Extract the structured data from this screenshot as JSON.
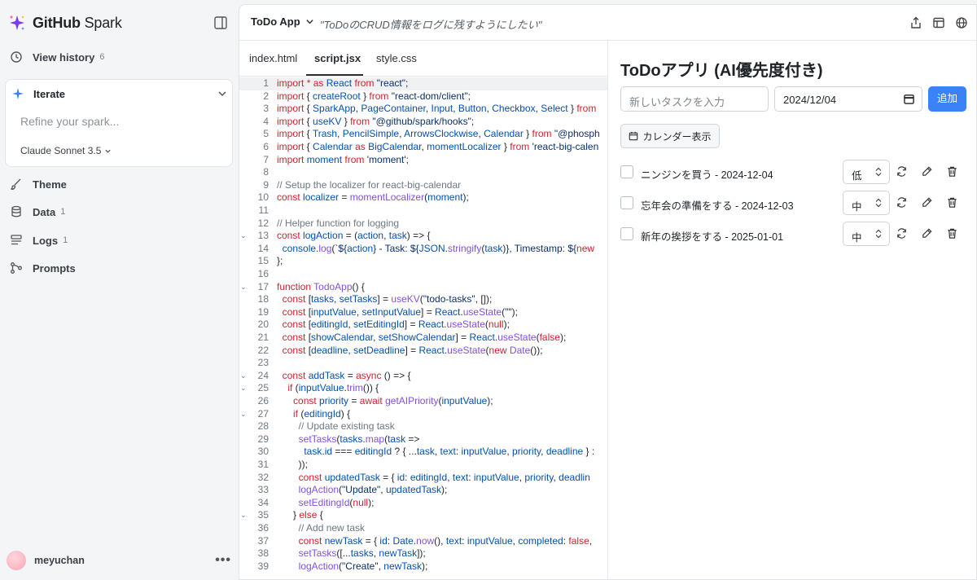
{
  "sidebar": {
    "brand_main": "GitHub",
    "brand_sub": " Spark",
    "view_history": {
      "label": "View history",
      "count": "6"
    },
    "iterate": {
      "label": "Iterate",
      "placeholder": "Refine your spark...",
      "model": "Claude Sonnet 3.5"
    },
    "items": [
      {
        "label": "Theme",
        "count": ""
      },
      {
        "label": "Data",
        "count": "1"
      },
      {
        "label": "Logs",
        "count": "1"
      },
      {
        "label": "Prompts",
        "count": ""
      }
    ],
    "user": "meyuchan"
  },
  "topbar": {
    "app_name": "ToDo App",
    "prompt": "\"ToDoのCRUD情報をログに残すようにしたい\""
  },
  "editor": {
    "tabs": [
      "index.html",
      "script.jsx",
      "style.css"
    ],
    "active_tab": "script.jsx",
    "lines": [
      {
        "n": "1",
        "fold": "",
        "html": "<span class=\"kw\">import</span> <span class=\"kw\">*</span> <span class=\"kw\">as</span> <span class=\"id\">React</span> <span class=\"kw\">from</span> <span class=\"str\">\"react\"</span>;"
      },
      {
        "n": "2",
        "fold": "",
        "html": "<span class=\"kw\">import</span> { <span class=\"id\">createRoot</span> } <span class=\"kw\">from</span> <span class=\"str\">\"react-dom/client\"</span>;"
      },
      {
        "n": "3",
        "fold": "",
        "html": "<span class=\"kw\">import</span> { <span class=\"id\">SparkApp</span>, <span class=\"id\">PageContainer</span>, <span class=\"id\">Input</span>, <span class=\"id\">Button</span>, <span class=\"id\">Checkbox</span>, <span class=\"id\">Select</span> } <span class=\"kw\">from</span>"
      },
      {
        "n": "4",
        "fold": "",
        "html": "<span class=\"kw\">import</span> { <span class=\"id\">useKV</span> } <span class=\"kw\">from</span> <span class=\"str\">\"@github/spark/hooks\"</span>;"
      },
      {
        "n": "5",
        "fold": "",
        "html": "<span class=\"kw\">import</span> { <span class=\"id\">Trash</span>, <span class=\"id\">PencilSimple</span>, <span class=\"id\">ArrowsClockwise</span>, <span class=\"id\">Calendar</span> } <span class=\"kw\">from</span> <span class=\"str\">\"@phosph</span>"
      },
      {
        "n": "6",
        "fold": "",
        "html": "<span class=\"kw\">import</span> { <span class=\"id\">Calendar</span> <span class=\"kw\">as</span> <span class=\"id\">BigCalendar</span>, <span class=\"id\">momentLocalizer</span> } <span class=\"kw\">from</span> <span class=\"str\">'react-big-calen</span>"
      },
      {
        "n": "7",
        "fold": "",
        "html": "<span class=\"kw\">import</span> <span class=\"id\">moment</span> <span class=\"kw\">from</span> <span class=\"str\">'moment'</span>;"
      },
      {
        "n": "8",
        "fold": "",
        "html": ""
      },
      {
        "n": "9",
        "fold": "",
        "html": "<span class=\"cm\">// Setup the localizer for react-big-calendar</span>"
      },
      {
        "n": "10",
        "fold": "",
        "html": "<span class=\"kw\">const</span> <span class=\"id\">localizer</span> = <span class=\"fn\">momentLocalizer</span>(<span class=\"id\">moment</span>);"
      },
      {
        "n": "11",
        "fold": "",
        "html": ""
      },
      {
        "n": "12",
        "fold": "",
        "html": "<span class=\"cm\">// Helper function for logging</span>"
      },
      {
        "n": "13",
        "fold": "⌄",
        "html": "<span class=\"kw\">const</span> <span class=\"id\">logAction</span> = (<span class=\"id\">action</span>, <span class=\"id\">task</span>) => {"
      },
      {
        "n": "14",
        "fold": "",
        "html": "  <span class=\"id\">console</span>.<span class=\"fn\">log</span>(<span class=\"str\">`${</span><span class=\"id\">action</span><span class=\"str\">} - Task: ${</span><span class=\"id\">JSON</span>.<span class=\"fn\">stringify</span>(<span class=\"id\">task</span>)<span class=\"str\">}, Timestamp: ${</span><span class=\"kw\">new</span>"
      },
      {
        "n": "15",
        "fold": "",
        "html": "};"
      },
      {
        "n": "16",
        "fold": "",
        "html": ""
      },
      {
        "n": "17",
        "fold": "⌄",
        "html": "<span class=\"kw\">function</span> <span class=\"fn\">TodoApp</span>() {"
      },
      {
        "n": "18",
        "fold": "",
        "html": "  <span class=\"kw\">const</span> [<span class=\"id\">tasks</span>, <span class=\"id\">setTasks</span>] = <span class=\"fn\">useKV</span>(<span class=\"str\">\"todo-tasks\"</span>, []);"
      },
      {
        "n": "19",
        "fold": "",
        "html": "  <span class=\"kw\">const</span> [<span class=\"id\">inputValue</span>, <span class=\"id\">setInputValue</span>] = <span class=\"id\">React</span>.<span class=\"fn\">useState</span>(<span class=\"str\">\"\"</span>);"
      },
      {
        "n": "20",
        "fold": "",
        "html": "  <span class=\"kw\">const</span> [<span class=\"id\">editingId</span>, <span class=\"id\">setEditingId</span>] = <span class=\"id\">React</span>.<span class=\"fn\">useState</span>(<span class=\"bool\">null</span>);"
      },
      {
        "n": "21",
        "fold": "",
        "html": "  <span class=\"kw\">const</span> [<span class=\"id\">showCalendar</span>, <span class=\"id\">setShowCalendar</span>] = <span class=\"id\">React</span>.<span class=\"fn\">useState</span>(<span class=\"bool\">false</span>);"
      },
      {
        "n": "22",
        "fold": "",
        "html": "  <span class=\"kw\">const</span> [<span class=\"id\">deadline</span>, <span class=\"id\">setDeadline</span>] = <span class=\"id\">React</span>.<span class=\"fn\">useState</span>(<span class=\"kw\">new</span> <span class=\"fn\">Date</span>());"
      },
      {
        "n": "23",
        "fold": "",
        "html": ""
      },
      {
        "n": "24",
        "fold": "⌄",
        "html": "  <span class=\"kw\">const</span> <span class=\"id\">addTask</span> = <span class=\"kw\">async</span> () => {"
      },
      {
        "n": "25",
        "fold": "⌄",
        "html": "    <span class=\"kw\">if</span> (<span class=\"id\">inputValue</span>.<span class=\"fn\">trim</span>()) {"
      },
      {
        "n": "26",
        "fold": "",
        "html": "      <span class=\"kw\">const</span> <span class=\"id\">priority</span> = <span class=\"kw\">await</span> <span class=\"fn\">getAIPriority</span>(<span class=\"id\">inputValue</span>);"
      },
      {
        "n": "27",
        "fold": "⌄",
        "html": "      <span class=\"kw\">if</span> (<span class=\"id\">editingId</span>) {"
      },
      {
        "n": "28",
        "fold": "",
        "html": "        <span class=\"cm\">// Update existing task</span>"
      },
      {
        "n": "29",
        "fold": "",
        "html": "        <span class=\"fn\">setTasks</span>(<span class=\"id\">tasks</span>.<span class=\"fn\">map</span>(<span class=\"id\">task</span> =>"
      },
      {
        "n": "30",
        "fold": "",
        "html": "          <span class=\"id\">task</span>.<span class=\"id\">id</span> === <span class=\"id\">editingId</span> ? { ...<span class=\"id\">task</span>, <span class=\"id\">text</span>: <span class=\"id\">inputValue</span>, <span class=\"id\">priority</span>, <span class=\"id\">deadline</span> } :"
      },
      {
        "n": "31",
        "fold": "",
        "html": "        ));"
      },
      {
        "n": "32",
        "fold": "",
        "html": "        <span class=\"kw\">const</span> <span class=\"id\">updatedTask</span> = { <span class=\"id\">id</span>: <span class=\"id\">editingId</span>, <span class=\"id\">text</span>: <span class=\"id\">inputValue</span>, <span class=\"id\">priority</span>, <span class=\"id\">deadlin</span>"
      },
      {
        "n": "33",
        "fold": "",
        "html": "        <span class=\"fn\">logAction</span>(<span class=\"str\">\"Update\"</span>, <span class=\"id\">updatedTask</span>);"
      },
      {
        "n": "34",
        "fold": "",
        "html": "        <span class=\"fn\">setEditingId</span>(<span class=\"bool\">null</span>);"
      },
      {
        "n": "35",
        "fold": "⌄",
        "html": "      } <span class=\"kw\">else</span> {"
      },
      {
        "n": "36",
        "fold": "",
        "html": "        <span class=\"cm\">// Add new task</span>"
      },
      {
        "n": "37",
        "fold": "",
        "html": "        <span class=\"kw\">const</span> <span class=\"id\">newTask</span> = { <span class=\"id\">id</span>: <span class=\"id\">Date</span>.<span class=\"fn\">now</span>(), <span class=\"id\">text</span>: <span class=\"id\">inputValue</span>, <span class=\"id\">completed</span>: <span class=\"bool\">false</span>,"
      },
      {
        "n": "38",
        "fold": "",
        "html": "        <span class=\"fn\">setTasks</span>([...<span class=\"id\">tasks</span>, <span class=\"id\">newTask</span>]);"
      },
      {
        "n": "39",
        "fold": "",
        "html": "        <span class=\"fn\">logAction</span>(<span class=\"str\">\"Create\"</span>, <span class=\"id\">newTask</span>);"
      }
    ]
  },
  "preview": {
    "title": "ToDoアプリ (AI優先度付き)",
    "task_placeholder": "新しいタスクを入力",
    "date_value": "2024/12/04",
    "add_label": "追加",
    "calendar_label": "カレンダー表示",
    "todos": [
      {
        "text": "ニンジンを買う - 2024-12-04",
        "priority": "低"
      },
      {
        "text": "忘年会の準備をする - 2024-12-03",
        "priority": "中"
      },
      {
        "text": "新年の挨拶をする - 2025-01-01",
        "priority": "中"
      }
    ]
  },
  "colors": {
    "accent": "#3b82f6",
    "keyword": "#cf222e",
    "identifier": "#0550ae"
  }
}
